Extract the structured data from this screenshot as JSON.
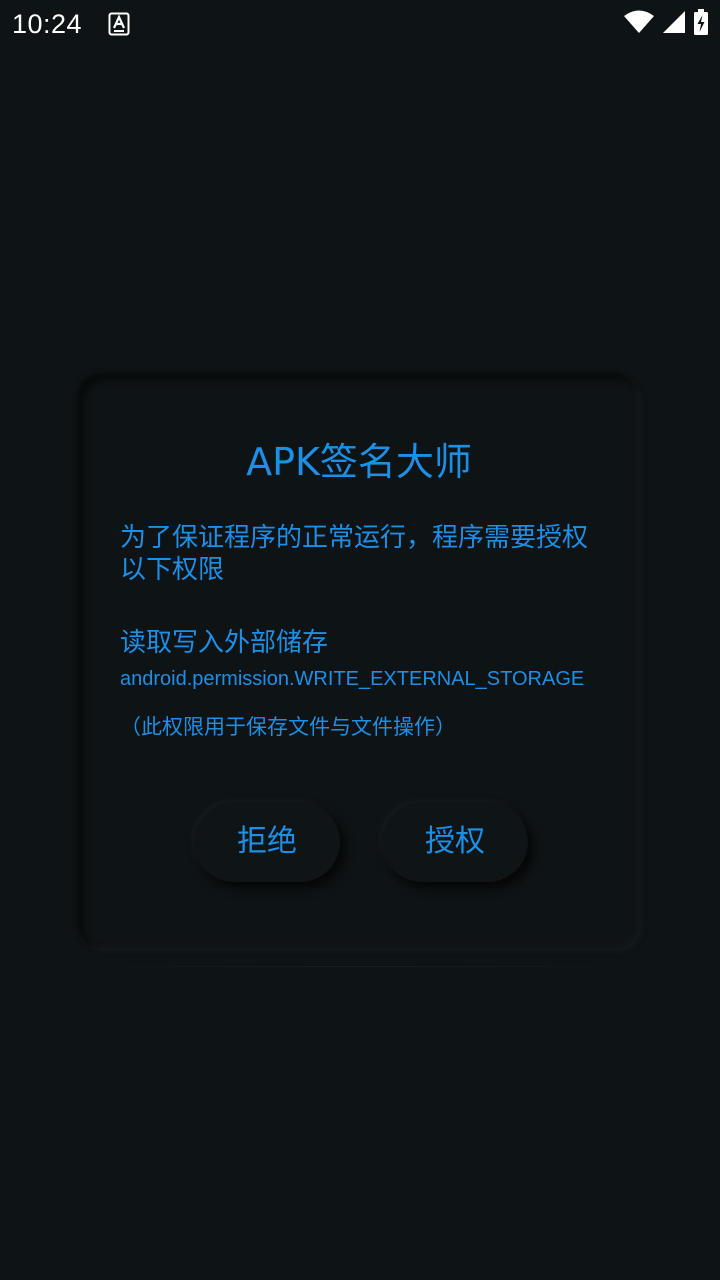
{
  "status_bar": {
    "time": "10:24",
    "icons": [
      "notification-a-icon",
      "wifi-icon",
      "signal-icon",
      "battery-charging-icon"
    ]
  },
  "dialog": {
    "title": "APK签名大师",
    "message": "为了保证程序的正常运行，程序需要授权以下权限",
    "permission": {
      "name": "读取写入外部储存",
      "id": "android.permission.WRITE_EXTERNAL_STORAGE",
      "description": "（此权限用于保存文件与文件操作）"
    },
    "buttons": {
      "deny_label": "拒绝",
      "grant_label": "授权"
    }
  },
  "colors": {
    "background": "#0e1315",
    "accent": "#1e8fe6",
    "status_text": "#ffffff"
  }
}
